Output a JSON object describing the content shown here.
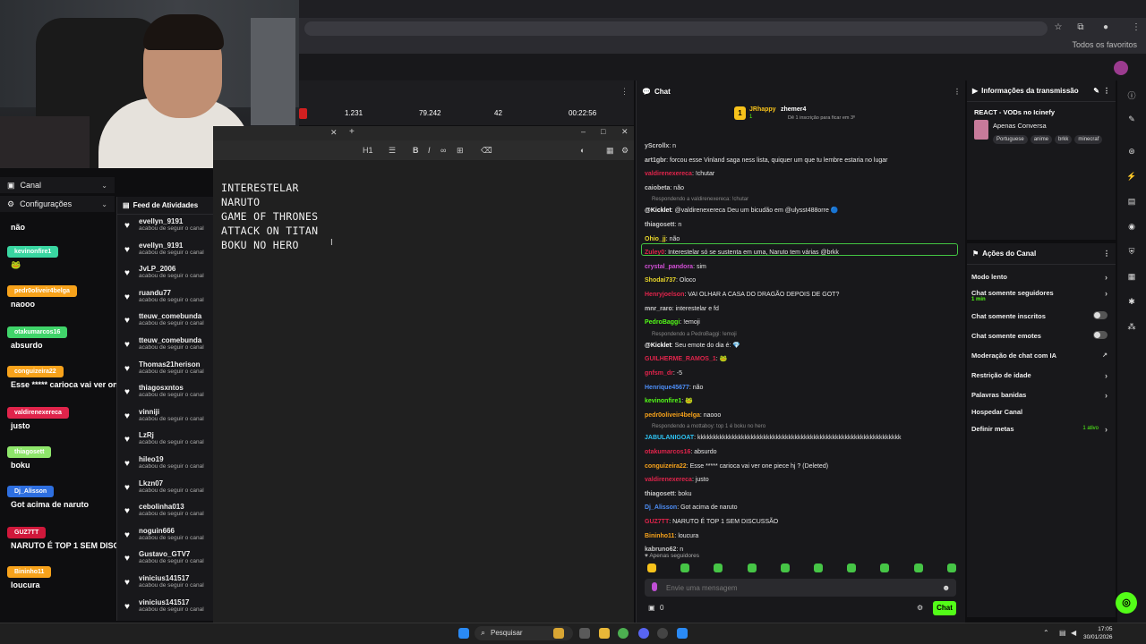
{
  "browser": {
    "bookmarks_all": "Todos os favoritos"
  },
  "left_menu": {
    "canal": "Canal",
    "configuracoes": "Configurações",
    "ghost_user": "Henrique45677"
  },
  "overlay": [
    {
      "user": "",
      "msg": "não",
      "color": "#2e2e33"
    },
    {
      "user": "kevinonfire1",
      "msg": "🐸",
      "color": "#39d6a1"
    },
    {
      "user": "pedr0oliveir4belga",
      "msg": "naooo",
      "color": "#f7a21b"
    },
    {
      "user": "otakumarcos16",
      "msg": "absurdo",
      "color": "#40d46a"
    },
    {
      "user": "conguizeira22",
      "msg": "Esse ***** carioca vai ver one piece hj ?",
      "color": "#f7a21b"
    },
    {
      "user": "valdirenexereca",
      "msg": "justo",
      "color": "#e0244b"
    },
    {
      "user": "thiagosett",
      "msg": "boku",
      "color": "#8ee66b"
    },
    {
      "user": "Dj_Alisson",
      "msg": "Got acima de naruto",
      "color": "#2e6fe0"
    },
    {
      "user": "GUZ7TT",
      "msg": "NARUTO É TOP 1 SEM DISCUSSÃO",
      "color": "#d0183b"
    },
    {
      "user": "Bininho11",
      "msg": "loucura",
      "color": "#f7a21b"
    }
  ],
  "feed": {
    "title": "Feed de Atividades",
    "action": "acabou de seguir o canal",
    "items": [
      "evellyn_9191",
      "evellyn_9191",
      "JvLP_2006",
      "ruandu77",
      "tteuw_comebunda",
      "tteuw_comebunda",
      "Thomas21herison",
      "thiagosxntos",
      "vinniji",
      "LzRj",
      "hileo19",
      "Lkzn07",
      "cebolinha013",
      "noguin666",
      "Gustavo_GTV7",
      "vinicius141517",
      "vinicius141517"
    ]
  },
  "stats": [
    "1.231",
    "79.242",
    "42",
    "00:22:56"
  ],
  "editor": {
    "lines": [
      "INTERESTELAR",
      "NARUTO",
      "GAME OF THRONES",
      "ATTACK ON TITAN",
      "BOKU NO HERO"
    ],
    "heading": "H1"
  },
  "chat": {
    "title": "Chat",
    "pinned_user1": "JRhappy",
    "pinned_count1": "1",
    "pinned_user2": "zhemer4",
    "pinned_sub": "Dê 1 inscrição para ficar em 3º",
    "messages": [
      {
        "user": "yScrollx",
        "text": "n",
        "color": "#c9c9c9"
      },
      {
        "user": "art1gbr",
        "text": "forcou esse Vinland saga ness lista, quiquer um que tu lembre estaria no lugar",
        "color": "#c9c9c9"
      },
      {
        "user": "valdirenexereca",
        "text": "!chutar",
        "color": "#e0244b"
      },
      {
        "user": "caiobeta",
        "text": "não",
        "color": "#c9c9c9"
      },
      {
        "user": "@Kicklet",
        "text": "@valdirenexereca Deu um bicudão em @ulysst488orre 🔵",
        "color": "#fff",
        "reply": "Respondendo a valdirenexereca: !chutar"
      },
      {
        "user": "thiagosett",
        "text": "n",
        "color": "#c9c9c9"
      },
      {
        "user": "Ohio_jj",
        "text": "não",
        "color": "#e8d62a"
      },
      {
        "user": "Zuley0",
        "text": "Interestelar só se sustenta em uma, Naruto tem várias @brkk",
        "color": "#e0244b"
      },
      {
        "user": "crystal_pandora",
        "text": "sim",
        "color": "#d24fd6"
      },
      {
        "user": "Shodai737",
        "text": "Oloco",
        "color": "#e8d62a"
      },
      {
        "user": "Henryjoelson",
        "text": "VAI OLHAR A CASA DO DRAGÃO DEPOIS DE GOT?",
        "color": "#e0244b"
      },
      {
        "user": "mnr_raro",
        "text": "interestelar e fd",
        "color": "#c9c9c9"
      },
      {
        "user": "PedroBaggi",
        "text": "!emoji",
        "color": "#53fc18"
      },
      {
        "user": "@Kicklet",
        "text": "Seu emote do dia é: 💎",
        "color": "#fff",
        "reply": "Respondendo a PedroBaggi: !emoji"
      },
      {
        "user": "GUILHERME_RAMOS_1",
        "text": "🐸",
        "color": "#e0244b"
      },
      {
        "user": "gnfsm_dr",
        "text": "-5",
        "color": "#e0244b"
      },
      {
        "user": "Henrique45677",
        "text": "não",
        "color": "#4d8ef7"
      },
      {
        "user": "kevinonfire1",
        "text": "🐸",
        "color": "#53fc18"
      },
      {
        "user": "pedr0oliveir4belga",
        "text": "naooo",
        "color": "#f7a21b"
      },
      {
        "user": "JABULANIGOAT",
        "text": "kkkkkkkkkkkkkkkkkkkkkkkkkkkkkkkkkkkkkkkkkkkkkkkkkkkkkkkkkkkkkkkkk",
        "color": "#2ec3f3",
        "reply": "Respondendo a mottaboy: top 1 é boku no hero"
      },
      {
        "user": "otakumarcos16",
        "text": "absurdo",
        "color": "#e0244b"
      },
      {
        "user": "conguizeira22",
        "text": "Esse ***** carioca vai ver one piece hj ? (Deleted)",
        "color": "#f7a21b"
      },
      {
        "user": "valdirenexereca",
        "text": "justo",
        "color": "#e0244b"
      },
      {
        "user": "thiagosett",
        "text": "boku",
        "color": "#c9c9c9"
      },
      {
        "user": "Dj_Alisson",
        "text": "Got acima de naruto",
        "color": "#4d8ef7"
      },
      {
        "user": "GUZ7TT",
        "text": "NARUTO É TOP 1 SEM DISCUSSÃO",
        "color": "#e0244b"
      },
      {
        "user": "Bininho11",
        "text": "loucura",
        "color": "#f7a21b"
      },
      {
        "user": "kabruno62",
        "text": "n",
        "color": "#c9c9c9"
      }
    ],
    "followers_only": "Apenas seguidores",
    "input_placeholder": "Envie uma mensagem",
    "send": "Chat",
    "counter": "0"
  },
  "info": {
    "title": "Informações da transmissão",
    "stream_title": "REACT - VODs no Icinefy",
    "category": "Apenas Conversa",
    "tags": [
      "Portuguese",
      "anime",
      "brkk",
      "minecraf"
    ]
  },
  "actions": {
    "title": "Ações do Canal",
    "items": [
      {
        "label": "Modo lento",
        "kind": "arrow"
      },
      {
        "label": "Chat somente seguidores",
        "kind": "arrow",
        "sub": "1 min"
      },
      {
        "label": "Chat somente inscritos",
        "kind": "toggle"
      },
      {
        "label": "Chat somente emotes",
        "kind": "toggle"
      },
      {
        "label": "Moderação de chat com IA",
        "kind": "ext"
      },
      {
        "label": "Restrição de idade",
        "kind": "arrow"
      },
      {
        "label": "Palavras banidas",
        "kind": "arrow"
      },
      {
        "label": "Hospedar Canal",
        "kind": "none"
      },
      {
        "label": "Definir metas",
        "kind": "arrow",
        "sub": "1 ativo"
      }
    ]
  },
  "taskbar": {
    "search": "Pesquisar",
    "time": "17:05",
    "date": "30/01/2026"
  },
  "colors": {
    "accent": "#53fc18",
    "bg": "#18181b"
  }
}
